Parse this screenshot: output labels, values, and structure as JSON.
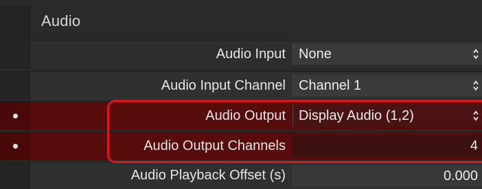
{
  "section": {
    "title": "Audio"
  },
  "rows": [
    {
      "label": "Audio Input",
      "value": "None",
      "kind": "select"
    },
    {
      "label": "Audio Input Channel",
      "value": "Channel 1",
      "kind": "select"
    },
    {
      "label": "Audio Output",
      "value": "Display Audio (1,2)",
      "kind": "select",
      "marked": true
    },
    {
      "label": "Audio Output Channels",
      "value": "4",
      "kind": "number",
      "marked": true
    },
    {
      "label": "Audio Playback Offset (s)",
      "value": "0.000",
      "kind": "number"
    }
  ],
  "colors": {
    "panel_bg": "#2a2a2a",
    "selected_row_bg": "#570b0b",
    "annotation_outline": "#e0161d",
    "text": "#e6e6e6"
  },
  "icons": {
    "stepper": "up-down-chevron-icon",
    "row_marker": "dot-icon"
  }
}
